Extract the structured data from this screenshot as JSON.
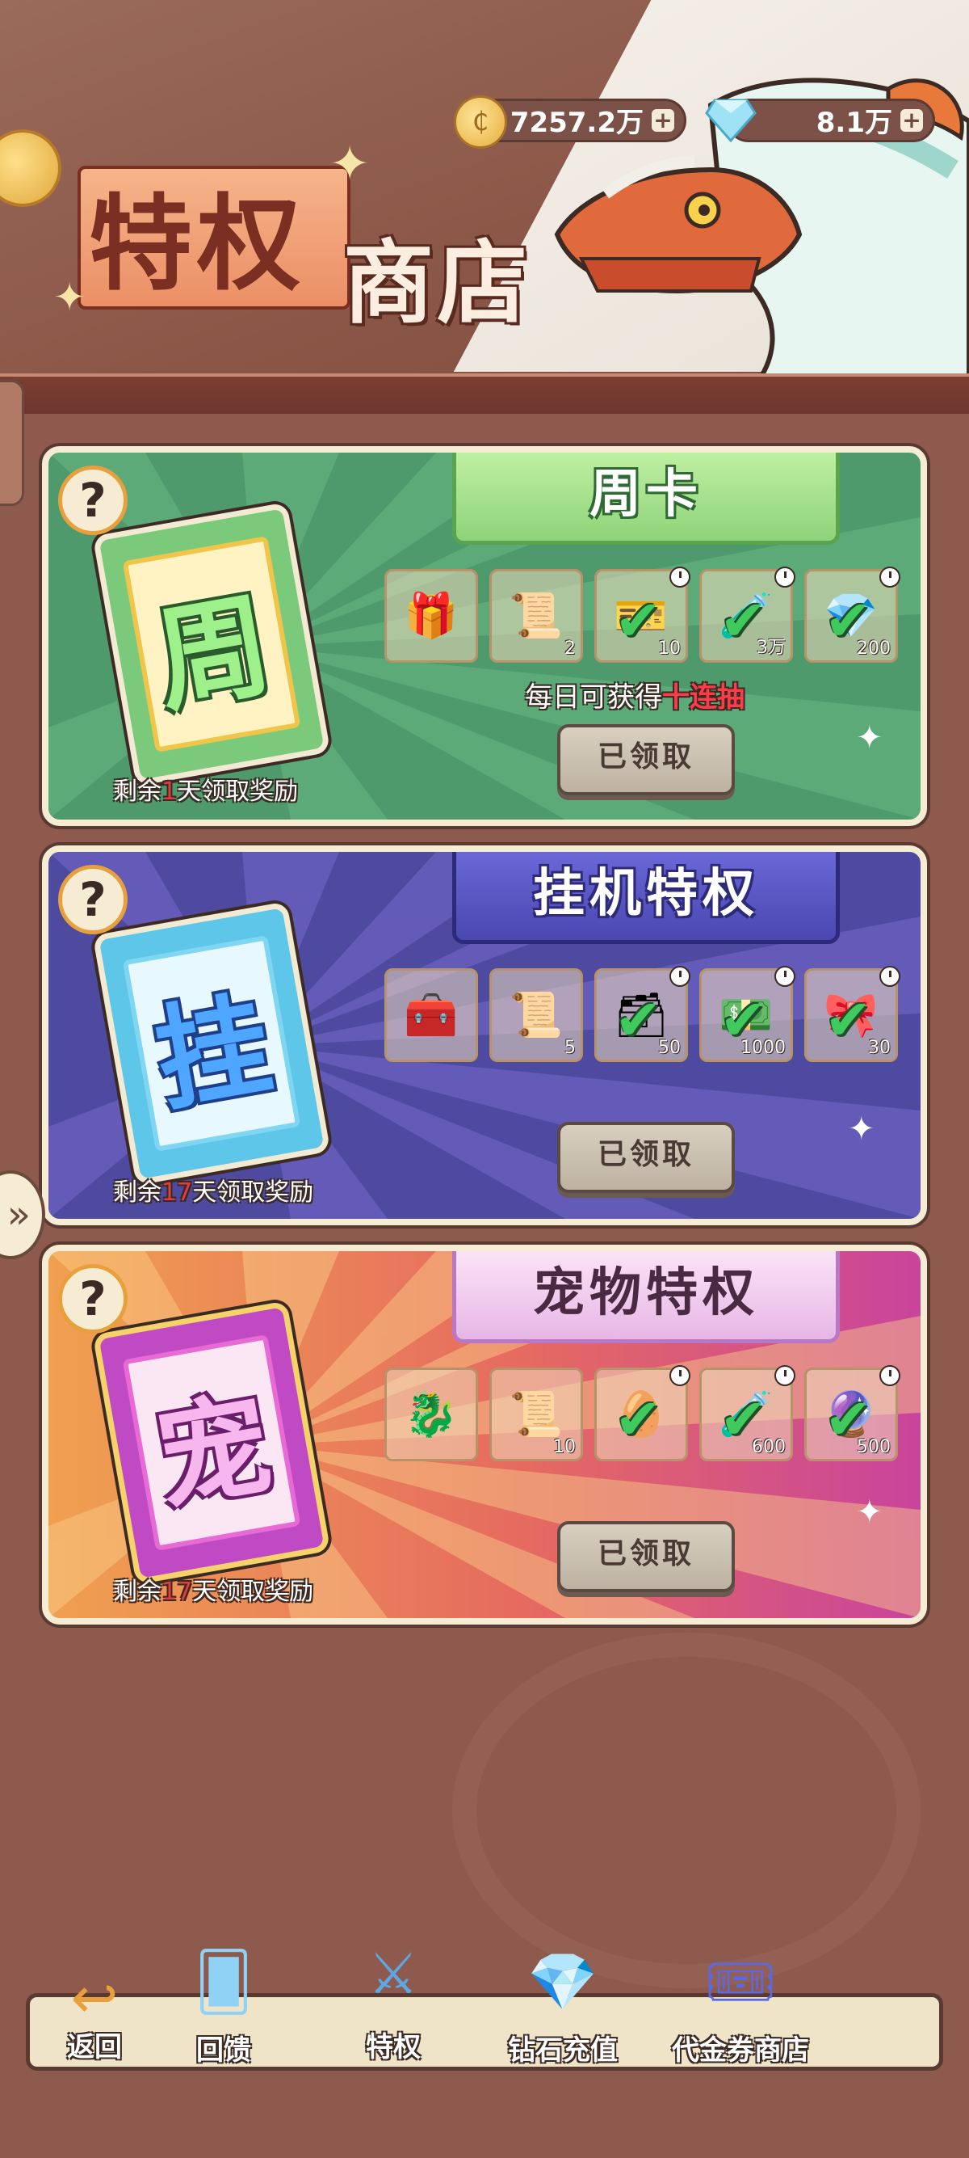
{
  "header": {
    "title_big": "特权",
    "title_small": "商店"
  },
  "currency": {
    "gold": "7257.2万",
    "diamond": "8.1万",
    "plus": "+"
  },
  "cards": [
    {
      "title": "周卡",
      "card_glyph": "周",
      "remain_prefix": "剩余",
      "remain_num": "1",
      "remain_suffix": "天领取奖励",
      "daily_prefix": "每日可获得",
      "daily_highlight": "十连抽",
      "button": "已领取",
      "items": [
        {
          "icon": "chest-icon",
          "qty": "",
          "claimed": false
        },
        {
          "icon": "scroll-icon",
          "qty": "2",
          "claimed": false
        },
        {
          "icon": "ticket-icon",
          "qty": "10",
          "claimed": true
        },
        {
          "icon": "potion-icon",
          "qty": "3万",
          "claimed": true
        },
        {
          "icon": "gem-icon",
          "qty": "200",
          "claimed": true
        }
      ]
    },
    {
      "title": "挂机特权",
      "card_glyph": "挂",
      "remain_prefix": "剩余",
      "remain_num": "17",
      "remain_suffix": "天领取奖励",
      "button": "已领取",
      "items": [
        {
          "icon": "treasure-icon",
          "qty": "",
          "claimed": false
        },
        {
          "icon": "scroll-icon",
          "qty": "5",
          "claimed": false
        },
        {
          "icon": "chest-icon",
          "qty": "50",
          "claimed": true
        },
        {
          "icon": "cash-icon",
          "qty": "1000",
          "claimed": true
        },
        {
          "icon": "gift-chest-icon",
          "qty": "30",
          "claimed": true
        }
      ]
    },
    {
      "title": "宠物特权",
      "card_glyph": "宠",
      "remain_prefix": "剩余",
      "remain_num": "17",
      "remain_suffix": "天领取奖励",
      "button": "已领取",
      "items": [
        {
          "icon": "pet-icon",
          "qty": "",
          "claimed": false
        },
        {
          "icon": "scroll-icon",
          "qty": "10",
          "claimed": false
        },
        {
          "icon": "egg-icon",
          "qty": "",
          "claimed": true
        },
        {
          "icon": "potion-icon",
          "qty": "600",
          "claimed": true
        },
        {
          "icon": "spiky-egg-icon",
          "qty": "500",
          "claimed": true
        }
      ]
    }
  ],
  "nav": {
    "back": "返回",
    "feedback": "回馈",
    "privilege": "特权",
    "diamond_recharge": "钻石充值",
    "voucher_shop": "代金券商店"
  },
  "colors": {
    "week_bg": "#4f9a6c",
    "idle_bg": "#4d4aa0",
    "pet_bg": "#e77c58",
    "highlight_red": "#ff3b4a",
    "check_green": "#40c95c"
  }
}
